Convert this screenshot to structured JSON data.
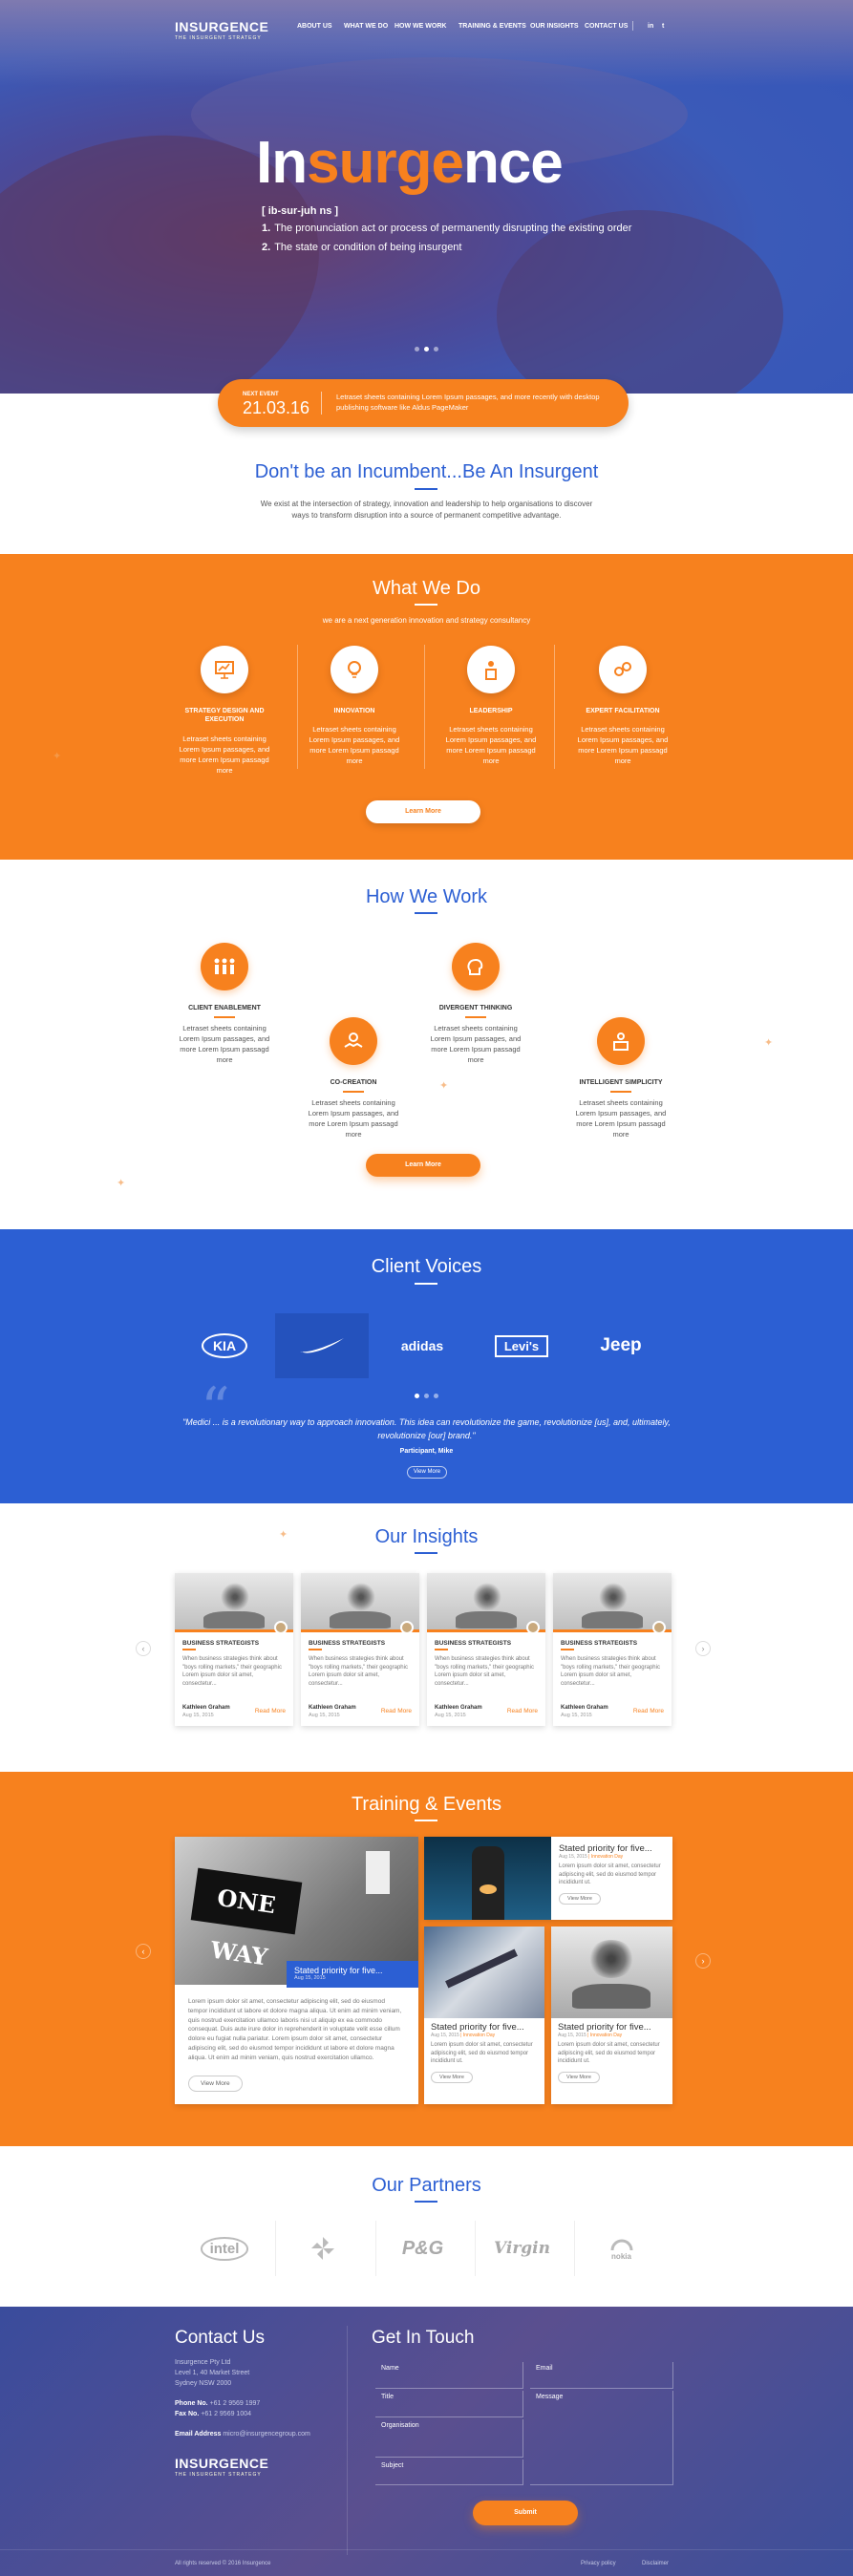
{
  "nav": {
    "logo": "INSURGENCE",
    "logo_sub": "THE INSURGENT STRATEGY",
    "items": [
      "ABOUT US",
      "WHAT WE DO",
      "HOW WE WORK",
      "TRAINING & EVENTS",
      "OUR INSIGHTS",
      "CONTACT US"
    ],
    "social": [
      "in",
      "t"
    ]
  },
  "hero": {
    "title_a": "In",
    "title_b": "surge",
    "title_c": "nce",
    "pronunciation": "[ ib-sur-juh ns ]",
    "def1_num": "1.",
    "def1": "The  pronunciation act or process of permanently disrupting the existing order",
    "def2_num": "2.",
    "def2": "The state or condition of being insurgent"
  },
  "event": {
    "label": "NEXT EVENT",
    "date": "21.03.16",
    "text": "Letraset sheets containing Lorem Ipsum passages, and more recently with desktop publishing software like Aldus PageMaker"
  },
  "intro": {
    "title": "Don't be an Incumbent...Be An Insurgent",
    "text": "We exist at the intersection of strategy, innovation and leadership to help organisations  to discover ways to transform disruption into a source of permanent competitive advantage."
  },
  "what_we_do": {
    "title": "What We Do",
    "subtitle": "we are a next generation innovation and strategy consultancy",
    "items": [
      {
        "title": "STRATEGY DESIGN AND EXECUTION",
        "text": "Letraset sheets containing Lorem Ipsum passages, and more Lorem Ipsum passagd more"
      },
      {
        "title": "INNOVATION",
        "text": "Letraset sheets containing Lorem Ipsum passages, and more Lorem Ipsum passagd more"
      },
      {
        "title": "LEADERSHIP",
        "text": "Letraset sheets containing Lorem Ipsum passages, and more Lorem Ipsum passagd more"
      },
      {
        "title": "EXPERT FACILITATION",
        "text": "Letraset sheets containing Lorem Ipsum passages, and more Lorem Ipsum passagd more"
      }
    ],
    "button": "Learn More"
  },
  "how_we_work": {
    "title": "How We Work",
    "items": [
      {
        "title": "CLIENT ENABLEMENT",
        "text": "Letraset sheets containing Lorem Ipsum passages, and more Lorem Ipsum passagd more"
      },
      {
        "title": "CO-CREATION",
        "text": "Letraset sheets containing Lorem Ipsum passages, and more Lorem Ipsum passagd more"
      },
      {
        "title": "DIVERGENT THINKING",
        "text": "Letraset sheets containing Lorem Ipsum passages, and more Lorem Ipsum passagd more"
      },
      {
        "title": "INTELLIGENT SIMPLICITY",
        "text": "Letraset sheets containing Lorem Ipsum passages, and more Lorem Ipsum passagd more"
      }
    ],
    "button": "Learn More"
  },
  "clients": {
    "title": "Client Voices",
    "brands": [
      "KIA",
      "NIKE",
      "adidas",
      "Levi's",
      "Jeep"
    ],
    "quote": "\"Medici ... is a revolutionary way to approach innovation. This idea can revolutionize the game, revolutionize [us], and, ultimately, revolutionize [our] brand.\"",
    "author": "Participant, Mike",
    "button": "View More"
  },
  "insights": {
    "title": "Our Insights",
    "cards": [
      {
        "category": "BUSINESS STRATEGISTS",
        "text": "When business strategies think about \"boys rolling markets,\" their geographic Lorem ipsum dolor sit amet, consectetur...",
        "author": "Kathleen Graham",
        "date": "Aug 15, 2015",
        "link": "Read More"
      },
      {
        "category": "BUSINESS STRATEGISTS",
        "text": "When business strategies think about \"boys rolling markets,\" their geographic Lorem ipsum dolor sit amet, consectetur...",
        "author": "Kathleen Graham",
        "date": "Aug 15, 2015",
        "link": "Read More"
      },
      {
        "category": "BUSINESS STRATEGISTS",
        "text": "When business strategies think about \"boys rolling markets,\" their geographic Lorem ipsum dolor sit amet, consectetur...",
        "author": "Kathleen Graham",
        "date": "Aug 15, 2015",
        "link": "Read More"
      },
      {
        "category": "BUSINESS STRATEGISTS",
        "text": "When business strategies think about \"boys rolling markets,\" their geographic Lorem ipsum dolor sit amet, consectetur...",
        "author": "Kathleen Graham",
        "date": "Aug 15, 2015",
        "link": "Read More"
      }
    ]
  },
  "training": {
    "title": "Training & Events",
    "main": {
      "image_text": "ONE WAY",
      "title": "Stated priority for five...",
      "date": "Aug 15, 2015",
      "text": "Lorem ipsum dolor sit amet, consectetur adipiscing elit, sed do eiusmod tempor incididunt ut labore et dolore magna aliqua. Ut enim ad minim veniam, quis nostrud exercitation ullamco laboris nisi ut aliquip ex ea commodo consequat. Duis aute irure dolor in reprehenderit in voluptate velit esse cillum dolore eu fugiat nulla pariatur. Lorem ipsum dolor sit amet, consectetur adipiscing elit, sed do eiusmod tempor incididunt ut labore et dolore magna aliqua. Ut enim ad minim veniam, quis nostrud exercitation ullamco.",
      "button": "View More"
    },
    "side": [
      {
        "title": "Stated priority for five...",
        "date": "Aug 15, 2015",
        "tag": "Innovation Day",
        "text": "Lorem ipsum dolor sit amet, consectetur adipiscing elit, sed do eiusmod tempor incididunt ut.",
        "button": "View More"
      },
      {
        "title": "Stated priority for five...",
        "date": "Aug 15, 2015",
        "tag": "Innovation Day",
        "text": "Lorem ipsum dolor sit amet, consectetur adipiscing elit, sed do eiusmod tempor incididunt ut.",
        "button": "View More"
      },
      {
        "title": "Stated priority for five...",
        "date": "Aug 15, 2015",
        "tag": "Innovation Day",
        "text": "Lorem ipsum dolor sit amet, consectetur adipiscing elit, sed do eiusmod tempor incididunt ut.",
        "button": "View More"
      }
    ]
  },
  "partners": {
    "title": "Our Partners",
    "items": [
      "intel",
      "",
      "P&G",
      "Virgin",
      "nokia"
    ]
  },
  "footer": {
    "contact_title": "Contact Us",
    "company": "Insurgence Pty Ltd",
    "addr1": "Level 1, 40 Market Street",
    "addr2": "Sydney NSW 2000",
    "phone_label": "Phone No.",
    "phone": "+61 2 9569 1997",
    "fax_label": "Fax No.",
    "fax": "+61 2 9569 1004",
    "email_label": "Email Address",
    "email": "micro@insurgencegroup.com",
    "logo": "INSURGENCE",
    "logo_sub": "THE INSURGENT STRATEGY",
    "form_title": "Get In Touch",
    "fields": {
      "name": "Name",
      "email": "Email",
      "title": "Title",
      "message": "Message",
      "organisation": "Organisation",
      "subject": "Subject"
    },
    "submit": "Submit",
    "copyright": "All rights reserved © 2016 Insurgence",
    "privacy": "Privacy policy",
    "disclaimer": "Disclaimer"
  },
  "colors": {
    "accent": "#f7811e",
    "blue": "#2c5fd3"
  }
}
